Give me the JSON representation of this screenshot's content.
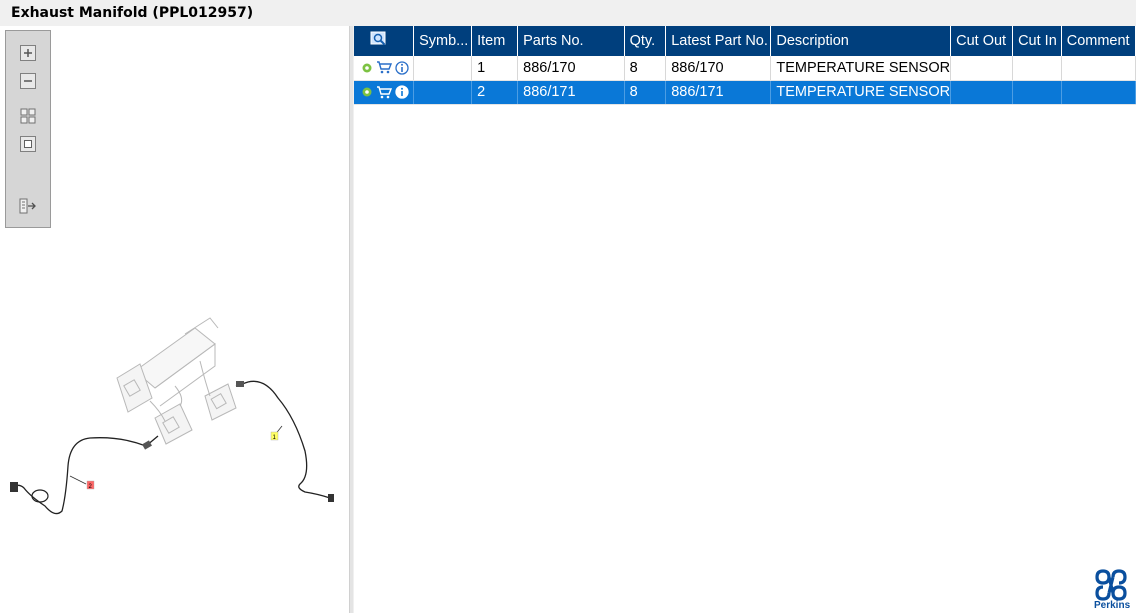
{
  "window": {
    "title": "Exhaust Manifold (PPL012957)"
  },
  "toolbar": {
    "buttons": [
      {
        "name": "zoom-in",
        "icon": "plus-icon"
      },
      {
        "name": "zoom-out",
        "icon": "minus-icon"
      },
      {
        "name": "fit-all",
        "icon": "fit-icon"
      },
      {
        "name": "actual-size",
        "icon": "square-icon"
      },
      {
        "name": "export",
        "icon": "export-icon"
      }
    ]
  },
  "drawing": {
    "callouts": [
      {
        "label": "1",
        "color": "#ffff66"
      },
      {
        "label": "2",
        "color": "#ff6666"
      }
    ]
  },
  "table": {
    "columns": [
      "",
      "Symb...",
      "Item",
      "Parts No.",
      "Qty.",
      "Latest Part No.",
      "Description",
      "Cut Out",
      "Cut In",
      "Comment"
    ],
    "rows": [
      {
        "item": "1",
        "part_no": "886/170",
        "qty": "8",
        "latest_part_no": "886/170",
        "description": "TEMPERATURE SENSOR",
        "selected": false
      },
      {
        "item": "2",
        "part_no": "886/171",
        "qty": "8",
        "latest_part_no": "886/171",
        "description": "TEMPERATURE SENSOR",
        "selected": true
      }
    ]
  },
  "brand": {
    "name": "Perkins"
  },
  "colors": {
    "header": "#003f7d",
    "selected_row": "#0a78d7",
    "brand": "#0a4f9e"
  }
}
